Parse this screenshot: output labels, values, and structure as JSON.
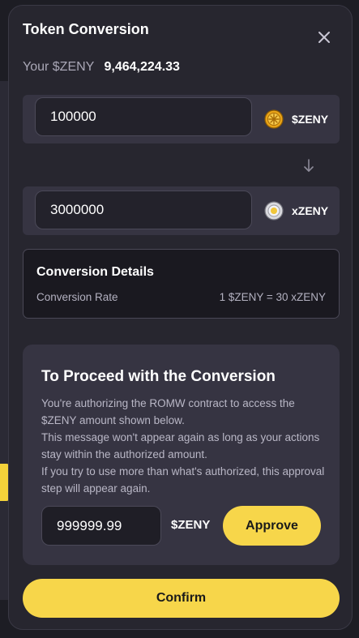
{
  "modal": {
    "title": "Token Conversion",
    "balance_label": "Your $ZENY",
    "balance_value": "9,464,224.33"
  },
  "from": {
    "value": "100000",
    "token": "$ZENY",
    "icon": "zeny-coin-icon"
  },
  "to": {
    "value": "3000000",
    "token": "xZENY",
    "icon": "xzeny-coin-icon"
  },
  "details": {
    "title": "Conversion Details",
    "rate_label": "Conversion Rate",
    "rate_value": "1 $ZENY = 30 xZENY"
  },
  "proceed": {
    "title": "To Proceed with the Conversion",
    "paragraphs": [
      "You're authorizing the ROMW contract to access the $ZENY amount shown below.",
      "This message won't appear again as long as your actions stay within the authorized amount.",
      "If you try to use more than what's authorized, this approval step will appear again."
    ],
    "approve_amount": "999999.99",
    "approve_token": "$ZENY",
    "approve_label": "Approve"
  },
  "confirm_label": "Confirm",
  "colors": {
    "accent": "#f7d64a",
    "modal_bg": "#27262f",
    "panel_bg": "#363442",
    "muted_text": "#b3b1c0"
  }
}
